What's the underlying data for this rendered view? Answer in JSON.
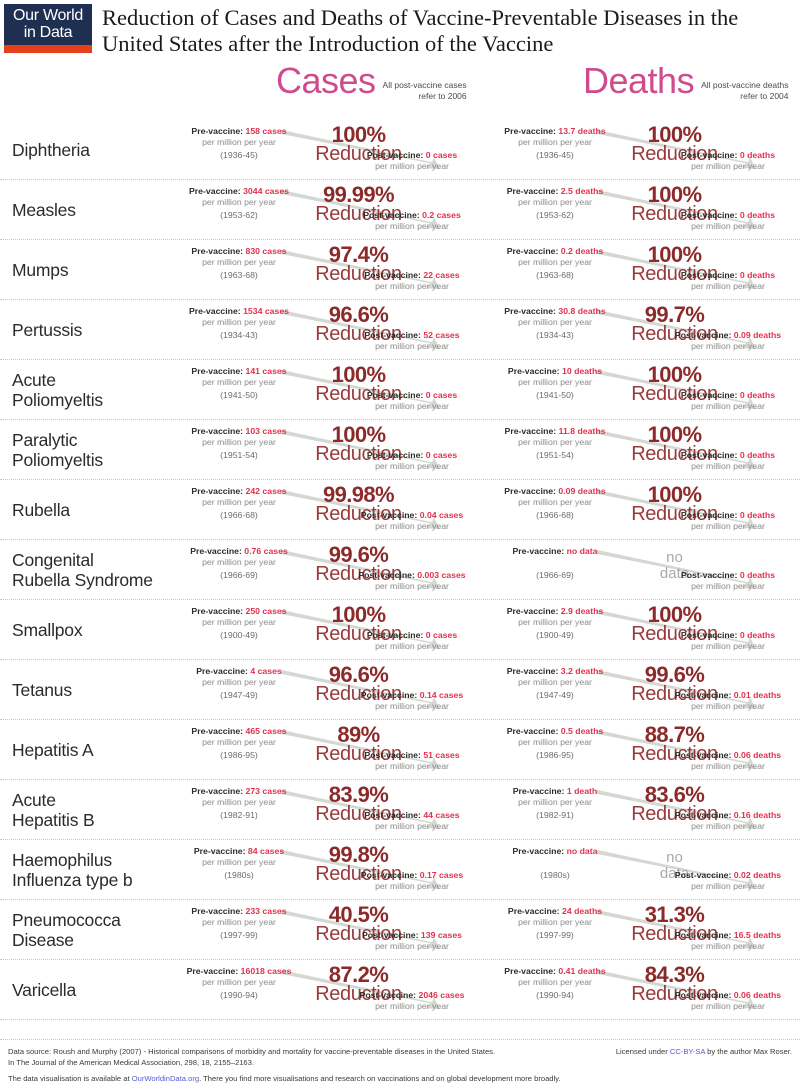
{
  "logo": {
    "line1": "Our World",
    "line2": "in Data"
  },
  "header": {
    "title": "Reduction of Cases and Deaths of Vaccine-Preventable Diseases in the United States after the Introduction of the Vaccine"
  },
  "columns": {
    "cases": {
      "label": "Cases",
      "note": "All post-vaccine cases\nrefer to 2006"
    },
    "deaths": {
      "label": "Deaths",
      "note": "All post-vaccine deaths\nrefer to 2004"
    }
  },
  "labels": {
    "pre_prefix": "Pre-vaccine:",
    "post_prefix": "Post-vaccine:",
    "unit": "per million per year",
    "reduction": "Reduction",
    "nodata_line1": "no",
    "nodata_line2": "data",
    "nodata_value": "no data"
  },
  "colors": {
    "accent_pink": "#cf4b8f",
    "value_red": "#e0334e",
    "pct_dark_red": "#8c2a2a",
    "logo_navy": "#1f2f52",
    "logo_orange": "#e63f1c",
    "arrow_gray": "#d5d8d2",
    "nodata_gray": "#a9a9a9"
  },
  "rows": [
    {
      "disease": "Diphtheria",
      "cases": {
        "pre_value": "158 cases",
        "pre_years": "(1936-45)",
        "pct": "100%",
        "post_value": "0 cases"
      },
      "deaths": {
        "pre_value": "13.7 deaths",
        "pre_years": "(1936-45)",
        "pct": "100%",
        "post_value": "0 deaths"
      }
    },
    {
      "disease": "Measles",
      "cases": {
        "pre_value": "3044 cases",
        "pre_years": "(1953-62)",
        "pct": "99.99%",
        "post_value": "0.2 cases"
      },
      "deaths": {
        "pre_value": "2.5 deaths",
        "pre_years": "(1953-62)",
        "pct": "100%",
        "post_value": "0 deaths"
      }
    },
    {
      "disease": "Mumps",
      "cases": {
        "pre_value": "830 cases",
        "pre_years": "(1963-68)",
        "pct": "97.4%",
        "post_value": "22 cases"
      },
      "deaths": {
        "pre_value": "0.2 deaths",
        "pre_years": "(1963-68)",
        "pct": "100%",
        "post_value": "0 deaths"
      }
    },
    {
      "disease": "Pertussis",
      "cases": {
        "pre_value": "1534 cases",
        "pre_years": "(1934-43)",
        "pct": "96.6%",
        "post_value": "52 cases"
      },
      "deaths": {
        "pre_value": "30.8 deaths",
        "pre_years": "(1934-43)",
        "pct": "99.7%",
        "post_value": "0.09 deaths"
      }
    },
    {
      "disease": "Acute\n Poliomyeltis",
      "cases": {
        "pre_value": "141 cases",
        "pre_years": "(1941-50)",
        "pct": "100%",
        "post_value": "0 cases"
      },
      "deaths": {
        "pre_value": "10 deaths",
        "pre_years": "(1941-50)",
        "pct": "100%",
        "post_value": "0 deaths"
      }
    },
    {
      "disease": "Paralytic\n Poliomyeltis",
      "cases": {
        "pre_value": "103 cases",
        "pre_years": "(1951-54)",
        "pct": "100%",
        "post_value": "0 cases"
      },
      "deaths": {
        "pre_value": "11.8 deaths",
        "pre_years": "(1951-54)",
        "pct": "100%",
        "post_value": "0 deaths"
      }
    },
    {
      "disease": "Rubella",
      "cases": {
        "pre_value": "242 cases",
        "pre_years": "(1966-68)",
        "pct": "99.98%",
        "post_value": "0.04 cases"
      },
      "deaths": {
        "pre_value": "0.09 deaths",
        "pre_years": "(1966-68)",
        "pct": "100%",
        "post_value": "0 deaths"
      }
    },
    {
      "disease": "Congenital\n Rubella Syndrome",
      "cases": {
        "pre_value": "0.76 cases",
        "pre_years": "(1966-69)",
        "pct": "99.6%",
        "post_value": "0.003 cases"
      },
      "deaths": {
        "pre_value": "no data",
        "pre_years": "(1966-69)",
        "pct": "no data",
        "post_value": "0 deaths",
        "nodata": true
      }
    },
    {
      "disease": "Smallpox",
      "cases": {
        "pre_value": "250 cases",
        "pre_years": "(1900-49)",
        "pct": "100%",
        "post_value": "0 cases"
      },
      "deaths": {
        "pre_value": "2.9 deaths",
        "pre_years": "(1900-49)",
        "pct": "100%",
        "post_value": "0 deaths"
      }
    },
    {
      "disease": "Tetanus",
      "cases": {
        "pre_value": "4 cases",
        "pre_years": "(1947-49)",
        "pct": "96.6%",
        "post_value": "0.14 cases"
      },
      "deaths": {
        "pre_value": "3.2 deaths",
        "pre_years": "(1947-49)",
        "pct": "99.6%",
        "post_value": "0.01 deaths"
      }
    },
    {
      "disease": "Hepatitis A",
      "cases": {
        "pre_value": "465 cases",
        "pre_years": "(1986-95)",
        "pct": "89%",
        "post_value": "51 cases"
      },
      "deaths": {
        "pre_value": "0.5 deaths",
        "pre_years": "(1986-95)",
        "pct": "88.7%",
        "post_value": "0.06 deaths"
      }
    },
    {
      "disease": "Acute\n Hepatitis B",
      "cases": {
        "pre_value": "273 cases",
        "pre_years": "(1982-91)",
        "pct": "83.9%",
        "post_value": "44 cases"
      },
      "deaths": {
        "pre_value": "1 death",
        "pre_years": "(1982-91)",
        "pct": "83.6%",
        "post_value": "0.16 deaths"
      }
    },
    {
      "disease": "Haemophilus\n Influenza type b",
      "cases": {
        "pre_value": "84 cases",
        "pre_years": "(1980s)",
        "pct": "99.8%",
        "post_value": "0.17 cases"
      },
      "deaths": {
        "pre_value": "no data",
        "pre_years": "(1980s)",
        "pct": "no data",
        "post_value": "0.02 deaths",
        "nodata": true
      }
    },
    {
      "disease": "Pneumococca\n Disease",
      "cases": {
        "pre_value": "233 cases",
        "pre_years": "(1997-99)",
        "pct": "40.5%",
        "post_value": "139 cases"
      },
      "deaths": {
        "pre_value": "24 deaths",
        "pre_years": "(1997-99)",
        "pct": "31.3%",
        "post_value": "16.5 deaths"
      }
    },
    {
      "disease": "Varicella",
      "cases": {
        "pre_value": "16018 cases",
        "pre_years": "(1990-94)",
        "pct": "87.2%",
        "post_value": "2046 cases"
      },
      "deaths": {
        "pre_value": "0.41 deaths",
        "pre_years": "(1990-94)",
        "pct": "84.3%",
        "post_value": "0.06 deaths"
      }
    }
  ],
  "footer": {
    "source_line1": "Data source:  Roush and Murphy (2007) - Historical comparisons of morbidity and mortality for vaccine-preventable diseases in the United States.",
    "source_line2": "In The Journal of the American Medical Association, 298, 18, 2155–2163.",
    "license_pre": "Licensed under ",
    "license_link": "CC-BY-SA",
    "license_post": " by the author Max Roser.",
    "avail_pre": "The data visualisation is available at ",
    "avail_link": "OurWorldinData.org",
    "avail_post": ". There you find more visualisations and research on vaccinations and on global development more broadly."
  }
}
